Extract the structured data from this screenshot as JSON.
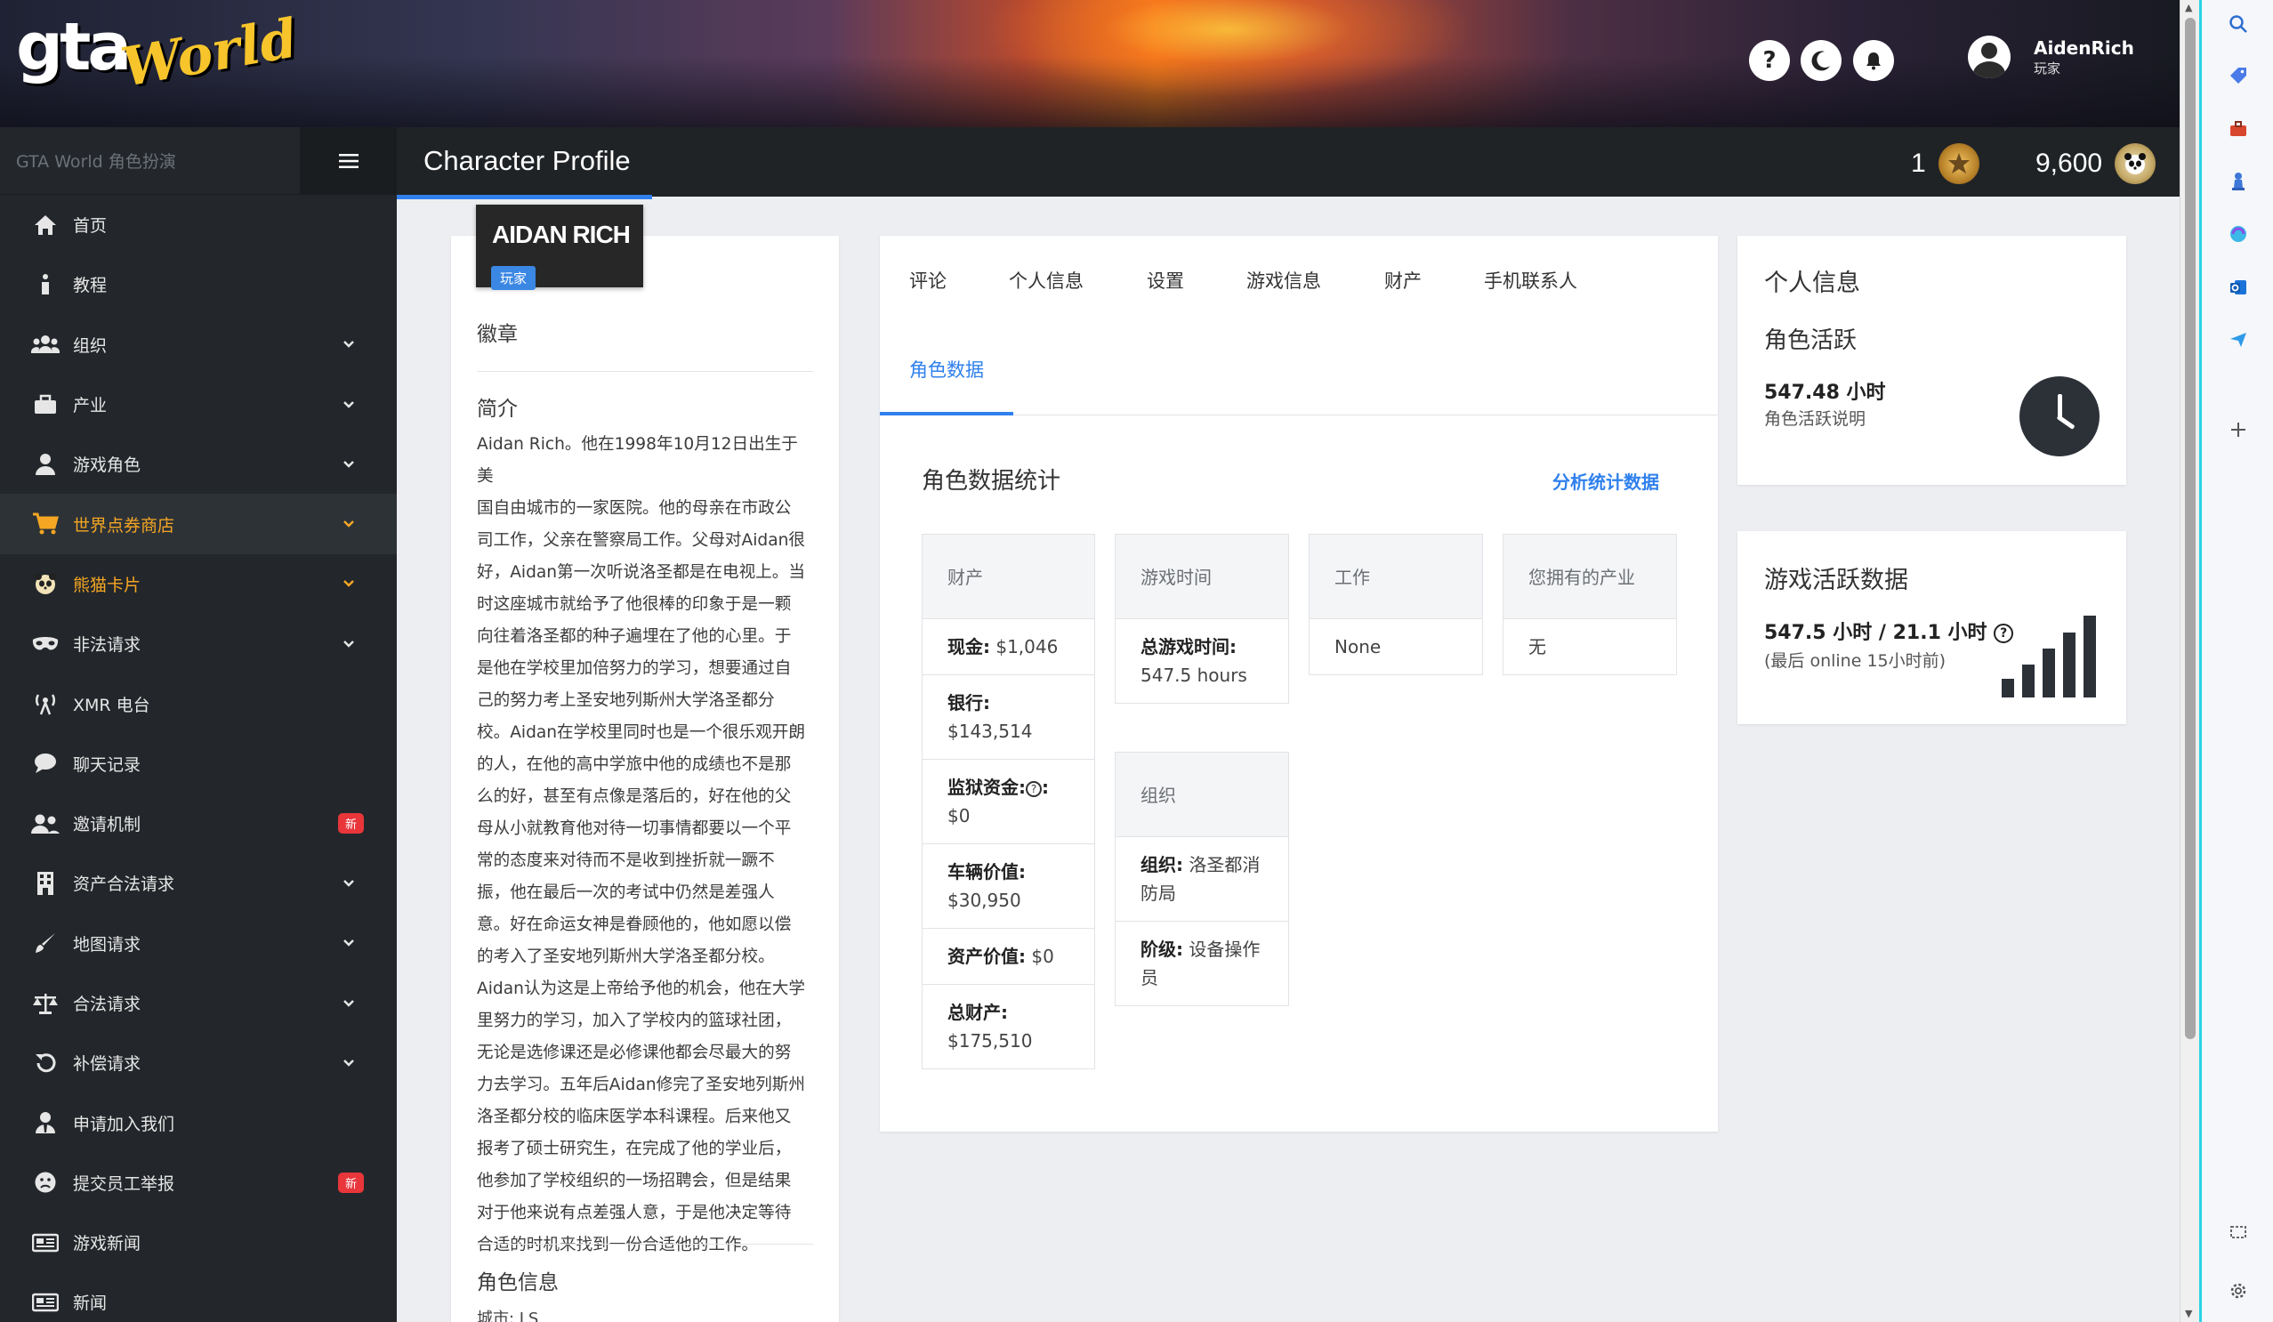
{
  "header": {
    "logo_gta": "gta",
    "logo_world": "World",
    "help_icon": "?",
    "user_name": "AidenRich",
    "user_role": "玩家"
  },
  "sidebar": {
    "title": "GTA World 角色扮演",
    "items": [
      {
        "label": "首页",
        "icon": "home-icon",
        "chevron": false,
        "badge": ""
      },
      {
        "label": "教程",
        "icon": "info-icon",
        "chevron": false,
        "badge": ""
      },
      {
        "label": "组织",
        "icon": "users-icon",
        "chevron": true,
        "badge": ""
      },
      {
        "label": "产业",
        "icon": "briefcase-icon",
        "chevron": true,
        "badge": ""
      },
      {
        "label": "游戏角色",
        "icon": "user-icon",
        "chevron": true,
        "badge": ""
      },
      {
        "label": "世界点券商店",
        "icon": "cart-icon",
        "chevron": true,
        "badge": ""
      },
      {
        "label": "熊猫卡片",
        "icon": "panda-icon",
        "chevron": true,
        "badge": ""
      },
      {
        "label": "非法请求",
        "icon": "mask-icon",
        "chevron": true,
        "badge": ""
      },
      {
        "label": "XMR 电台",
        "icon": "antenna-icon",
        "chevron": false,
        "badge": ""
      },
      {
        "label": "聊天记录",
        "icon": "chat-icon",
        "chevron": false,
        "badge": ""
      },
      {
        "label": "邀请机制",
        "icon": "invite-icon",
        "chevron": false,
        "badge": "新"
      },
      {
        "label": "资产合法请求",
        "icon": "building-icon",
        "chevron": true,
        "badge": ""
      },
      {
        "label": "地图请求",
        "icon": "brush-icon",
        "chevron": true,
        "badge": ""
      },
      {
        "label": "合法请求",
        "icon": "scale-icon",
        "chevron": true,
        "badge": ""
      },
      {
        "label": "补偿请求",
        "icon": "undo-icon",
        "chevron": true,
        "badge": ""
      },
      {
        "label": "申请加入我们",
        "icon": "user-tie-icon",
        "chevron": false,
        "badge": ""
      },
      {
        "label": "提交员工举报",
        "icon": "frown-icon",
        "chevron": false,
        "badge": "新"
      },
      {
        "label": "游戏新闻",
        "icon": "newspaper-icon",
        "chevron": false,
        "badge": ""
      },
      {
        "label": "新闻",
        "icon": "newspaper-icon",
        "chevron": false,
        "badge": ""
      }
    ]
  },
  "topbar": {
    "title": "Character Profile",
    "stat1_value": "1",
    "stat2_value": "9,600"
  },
  "profile": {
    "name": "AIDAN RICH",
    "role": "玩家",
    "badges_title": "徽章",
    "bio_title": "简介",
    "bio_lines": [
      "Aidan Rich。他在1998年10月12日出生于美",
      "国自由城市的一家医院。他的母亲在市政公",
      "司工作，父亲在警察局工作。父母对Aidan很",
      "好，Aidan第一次听说洛圣都是在电视上。当",
      "时这座城市就给予了他很棒的印象于是一颗",
      "向往着洛圣都的种子遍埋在了他的心里。于",
      "是他在学校里加倍努力的学习，想要通过自",
      "己的努力考上圣安地列斯州大学洛圣都分",
      "校。Aidan在学校里同时也是一个很乐观开朗",
      "的人，在他的高中学旅中他的成绩也不是那",
      "么的好，甚至有点像是落后的，好在他的父",
      "母从小就教育他对待一切事情都要以一个平",
      "常的态度来对待而不是收到挫折就一蹶不",
      "振，他在最后一次的考试中仍然是差强人",
      "意。好在命运女神是眷顾他的，他如愿以偿",
      "的考入了圣安地列斯州大学洛圣都分校。",
      "Aidan认为这是上帝给予他的机会，他在大学",
      "里努力的学习，加入了学校内的篮球社团，",
      "无论是选修课还是必修课他都会尽最大的努",
      "力去学习。五年后Aidan修完了圣安地列斯州",
      "洛圣都分校的临床医学本科课程。后来他又",
      "报考了硕士研究生，在完成了他的学业后，",
      "他参加了学校组织的一场招聘会，但是结果",
      "对于他来说有点差强人意，于是他决定等待",
      "合适的时机来找到一份合适他的工作。"
    ],
    "info_title": "角色信息",
    "info_partial": "城市: LS"
  },
  "tabs": [
    "评论",
    "个人信息",
    "设置",
    "游戏信息",
    "财产",
    "手机联系人",
    "角色数据"
  ],
  "stats": {
    "title": "角色数据统计",
    "link": "分析统计数据",
    "assets": {
      "header": "财产",
      "rows": [
        {
          "label": "现金:",
          "value": "$1,046"
        },
        {
          "label": "银行:",
          "value": "$143,514"
        },
        {
          "label": "监狱资金:",
          "value": "$0"
        },
        {
          "label": "车辆价值:",
          "value": "$30,950"
        },
        {
          "label": "资产价值:",
          "value": "$0"
        },
        {
          "label": "总财产:",
          "value": "$175,510"
        }
      ]
    },
    "playtime": {
      "header": "游戏时间",
      "label": "总游戏时间:",
      "value": "547.5 hours"
    },
    "job": {
      "header": "工作",
      "value": "None"
    },
    "properties": {
      "header": "您拥有的产业",
      "value": "无"
    },
    "org": {
      "header": "组织",
      "rows": [
        {
          "label": "组织:",
          "value": "洛圣都消防局"
        },
        {
          "label": "阶级:",
          "value": "设备操作员"
        }
      ]
    }
  },
  "right": {
    "card1_title": "个人信息",
    "card1_sub": "角色活跃",
    "card1_value": "547.48 小时",
    "card1_note": "角色活跃说明",
    "card2_title": "游戏活跃数据",
    "card2_value": "547.5 小时 / 21.1 小时",
    "card2_note": "(最后 online 15小时前)"
  },
  "colors": {
    "accent": "#2f80ed",
    "sidebar": "#23272b",
    "active_nav": "#f5a623",
    "badge": "#e8363b",
    "edge_border": "#29d3e6"
  }
}
